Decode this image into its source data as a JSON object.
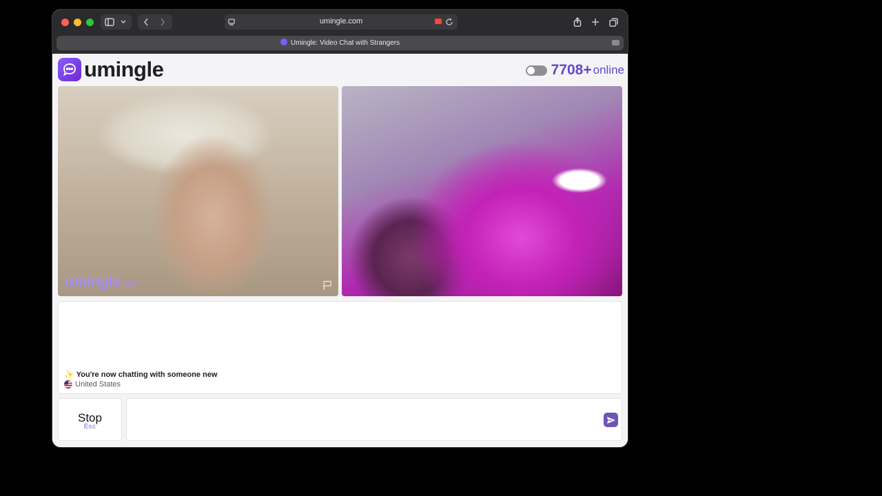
{
  "browser": {
    "url": "umingle.com",
    "tab_title": "Umingle: Video Chat with Strangers"
  },
  "header": {
    "logo_text": "umingle",
    "online_count": "7708+",
    "online_label": "online"
  },
  "video": {
    "watermark_main": "umingle",
    "watermark_suffix": ".com"
  },
  "chat": {
    "system_message": "You're now chatting with someone new",
    "country": "United States",
    "input_value": ""
  },
  "controls": {
    "stop_label": "Stop",
    "stop_shortcut": "Esc"
  },
  "colors": {
    "accent": "#6447c9",
    "send_button": "#6f55b5"
  }
}
